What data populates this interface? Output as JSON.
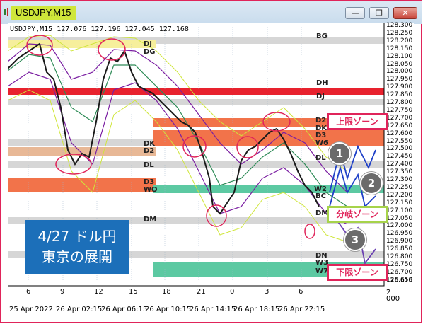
{
  "window": {
    "title": "USDJPY,M15",
    "btn_minimize": "—",
    "btn_restore": "❐",
    "btn_close": "✕"
  },
  "chart": {
    "header": "USDJPY,M15  127.076 127.196 127.045 127.168",
    "price_labels": [
      "128.300",
      "128.250",
      "128.200",
      "128.150",
      "128.100",
      "128.050",
      "128.000",
      "127.950",
      "127.900",
      "127.850",
      "127.800",
      "127.750",
      "127.700",
      "127.650",
      "127.600",
      "127.550",
      "127.500",
      "127.450",
      "127.400",
      "127.350",
      "127.300",
      "127.250",
      "127.200",
      "127.150",
      "127.100",
      "127.050",
      "127.000",
      "126.950",
      "126.900",
      "126.850",
      "126.800",
      "126.750",
      "126.700",
      "126.650",
      "126.616"
    ],
    "hour_labels": [
      "6",
      "9",
      "12",
      "15",
      "18",
      "21",
      "0",
      "3",
      "6"
    ],
    "date_labels": [
      "25 Apr 2022",
      "26 Apr 02:15",
      "26 Apr 06:15",
      "26 Apr 10:15",
      "26 Apr 14:15",
      "26 Apr 18:15",
      "26 Apr 22:15"
    ],
    "level_labels_left": [
      "DJ",
      "DG",
      "DK",
      "D2",
      "DL",
      "D3",
      "WO",
      "DM"
    ],
    "level_labels_right": [
      "BG",
      "DH",
      "DJ",
      "D2",
      "DK",
      "D3",
      "W6",
      "DL",
      "W2",
      "BC",
      "DM",
      "DN",
      "W3",
      "W7"
    ],
    "scale_corner": [
      "2",
      "000"
    ]
  },
  "annotations": {
    "note": [
      "4/27 ドル円",
      "東京の展開"
    ],
    "upper_zone": "上限ゾーン",
    "split_zone": "分岐ゾーン",
    "lower_zone": "下限ゾーン",
    "scenarios": [
      "1",
      "2",
      "3"
    ]
  },
  "colors": {
    "zone_red": "#e8222e",
    "zone_orange": "#f2734a",
    "zone_tan": "#e8b896",
    "zone_yellow": "#f6ef9c",
    "zone_green": "#5cc9a2",
    "zone_gray": "#d6d6d6",
    "accent_pink": "#e0245a",
    "note_blue": "#1c6fb9"
  }
}
